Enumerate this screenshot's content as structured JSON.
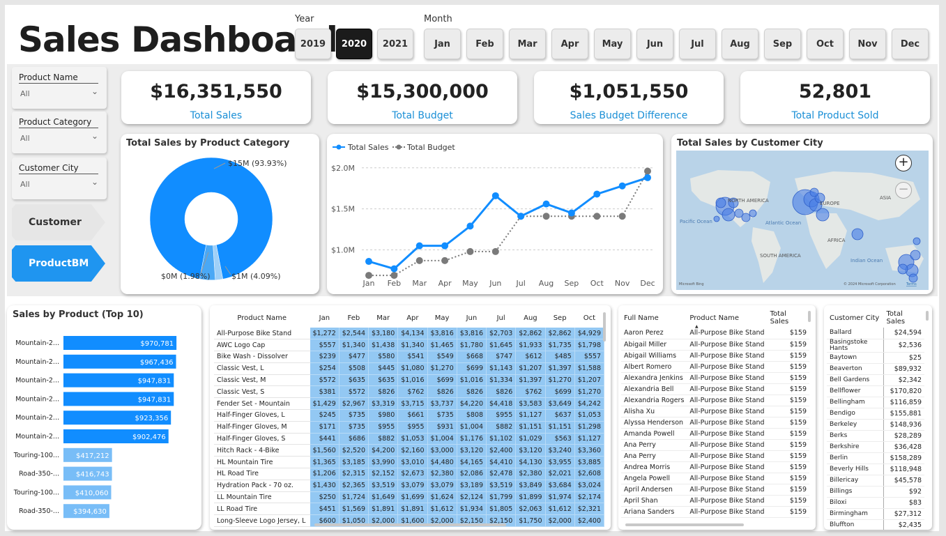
{
  "header": {
    "title": "Sales Dashboard"
  },
  "year_slicer": {
    "label": "Year",
    "options": [
      "2019",
      "2020",
      "2021"
    ],
    "selected": "2020"
  },
  "month_slicer": {
    "label": "Month",
    "options": [
      "Jan",
      "Feb",
      "Mar",
      "Apr",
      "May",
      "Jun",
      "Jul",
      "Aug",
      "Sep",
      "Oct",
      "Nov",
      "Dec"
    ]
  },
  "filters": [
    {
      "label": "Product Name",
      "value": "All"
    },
    {
      "label": "Product Category",
      "value": "All"
    },
    {
      "label": "Customer City",
      "value": "All"
    }
  ],
  "nav": {
    "customer": "Customer",
    "productbm": "ProductBM"
  },
  "kpis": [
    {
      "value": "$16,351,550",
      "label": "Total Sales"
    },
    {
      "value": "$15,300,000",
      "label": "Total Budget"
    },
    {
      "value": "$1,051,550",
      "label": "Sales Budget Difference"
    },
    {
      "value": "52,801",
      "label": "Total Product Sold"
    }
  ],
  "donut": {
    "title": "Total Sales by Product Category",
    "labels": [
      "$15M (93.93%)",
      "$0M (1.98%)",
      "$1M (4.09%)"
    ],
    "colors": [
      "#118dff",
      "#9fd0f8",
      "#4aa8f5"
    ]
  },
  "map": {
    "title": "Total Sales by Customer City",
    "labels": [
      "NORTH AMERICA",
      "EUROPE",
      "ASIA",
      "AFRICA",
      "SOUTH AMERICA",
      "Pacific Ocean",
      "Atlantic Ocean",
      "Indian Ocean"
    ],
    "attribution": "© 2024 Microsoft Corporation",
    "terms": "Terms",
    "logo": "Microsoft Bing"
  },
  "bar_table_title": "Sales by Product (Top 10)",
  "chart_data": [
    {
      "type": "pie",
      "title": "Total Sales by Product Category",
      "slices": [
        {
          "label": "$15M (93.93%)",
          "value": 93.93
        },
        {
          "label": "$0M (1.98%)",
          "value": 1.98
        },
        {
          "label": "$1M (4.09%)",
          "value": 4.09
        }
      ]
    },
    {
      "type": "line",
      "categories": [
        "Jan",
        "Feb",
        "Mar",
        "Apr",
        "May",
        "Jun",
        "Jul",
        "Aug",
        "Sep",
        "Oct",
        "Nov",
        "Dec"
      ],
      "yticks": [
        "$1.0M",
        "$1.5M",
        "$2.0M"
      ],
      "ylim": [
        0.75,
        2.1
      ],
      "series": [
        {
          "name": "Total Sales",
          "color": "#118dff",
          "values": [
            0.86,
            0.77,
            1.05,
            1.05,
            1.29,
            1.66,
            1.41,
            1.56,
            1.45,
            1.68,
            1.78,
            1.88
          ]
        },
        {
          "name": "Total Budget",
          "color": "#7a7a7a",
          "values": [
            0.69,
            0.69,
            0.87,
            0.87,
            0.98,
            0.98,
            1.41,
            1.41,
            1.41,
            1.41,
            1.41,
            1.96
          ]
        }
      ]
    },
    {
      "type": "bar",
      "title": "Sales by Product (Top 10)",
      "categories": [
        "Mountain-2...",
        "Mountain-2...",
        "Mountain-2...",
        "Mountain-2...",
        "Mountain-2...",
        "Mountain-2...",
        "Touring-100...",
        "Road-350-...",
        "Touring-100...",
        "Road-350-..."
      ],
      "values": [
        970781,
        967436,
        947831,
        947831,
        923356,
        902476,
        417212,
        416743,
        410060,
        394630
      ],
      "labels": [
        "$970,781",
        "$967,436",
        "$947,831",
        "$947,831",
        "$923,356",
        "$902,476",
        "$417,212",
        "$416,743",
        "$410,060",
        "$394,630"
      ],
      "xlim": [
        0,
        1000000
      ]
    }
  ],
  "matrix": {
    "headers": [
      "Product Name",
      "Jan",
      "Feb",
      "Mar",
      "Apr",
      "May",
      "Jun",
      "Jul",
      "Aug",
      "Sep",
      "Oct"
    ],
    "rows": [
      [
        "All-Purpose Bike Stand",
        "$1,272",
        "$2,544",
        "$3,180",
        "$4,134",
        "$3,816",
        "$3,816",
        "$2,703",
        "$2,862",
        "$2,862",
        "$4,929"
      ],
      [
        "AWC Logo Cap",
        "$557",
        "$1,340",
        "$1,438",
        "$1,340",
        "$1,465",
        "$1,780",
        "$1,645",
        "$1,933",
        "$1,735",
        "$1,798"
      ],
      [
        "Bike Wash - Dissolver",
        "$239",
        "$477",
        "$580",
        "$541",
        "$549",
        "$668",
        "$747",
        "$612",
        "$485",
        "$557"
      ],
      [
        "Classic Vest, L",
        "$254",
        "$508",
        "$445",
        "$1,080",
        "$1,270",
        "$699",
        "$1,143",
        "$1,207",
        "$1,397",
        "$1,588"
      ],
      [
        "Classic Vest, M",
        "$572",
        "$635",
        "$635",
        "$1,016",
        "$699",
        "$1,016",
        "$1,334",
        "$1,397",
        "$1,270",
        "$1,207"
      ],
      [
        "Classic Vest, S",
        "$381",
        "$572",
        "$826",
        "$762",
        "$826",
        "$826",
        "$826",
        "$762",
        "$699",
        "$1,270"
      ],
      [
        "Fender Set - Mountain",
        "$1,429",
        "$2,967",
        "$3,319",
        "$3,715",
        "$3,737",
        "$4,220",
        "$4,418",
        "$3,583",
        "$3,649",
        "$4,242"
      ],
      [
        "Half-Finger Gloves, L",
        "$245",
        "$735",
        "$980",
        "$661",
        "$735",
        "$808",
        "$955",
        "$1,127",
        "$637",
        "$1,053"
      ],
      [
        "Half-Finger Gloves, M",
        "$171",
        "$735",
        "$955",
        "$955",
        "$931",
        "$1,004",
        "$882",
        "$1,151",
        "$1,151",
        "$1,298"
      ],
      [
        "Half-Finger Gloves, S",
        "$441",
        "$686",
        "$882",
        "$1,053",
        "$1,004",
        "$1,176",
        "$1,102",
        "$1,029",
        "$563",
        "$1,127"
      ],
      [
        "Hitch Rack - 4-Bike",
        "$1,560",
        "$2,520",
        "$4,200",
        "$2,160",
        "$3,000",
        "$3,120",
        "$2,400",
        "$3,120",
        "$3,240",
        "$3,360"
      ],
      [
        "HL Mountain Tire",
        "$1,365",
        "$3,185",
        "$3,990",
        "$3,010",
        "$4,480",
        "$4,165",
        "$4,410",
        "$4,130",
        "$3,955",
        "$3,885"
      ],
      [
        "HL Road Tire",
        "$1,206",
        "$2,315",
        "$2,152",
        "$2,673",
        "$2,380",
        "$2,086",
        "$2,478",
        "$2,380",
        "$2,021",
        "$2,608"
      ],
      [
        "Hydration Pack - 70 oz.",
        "$1,430",
        "$2,365",
        "$3,519",
        "$3,079",
        "$3,079",
        "$3,189",
        "$3,519",
        "$3,849",
        "$3,684",
        "$3,024"
      ],
      [
        "LL Mountain Tire",
        "$250",
        "$1,724",
        "$1,649",
        "$1,699",
        "$1,624",
        "$2,124",
        "$1,799",
        "$1,899",
        "$1,974",
        "$2,174"
      ],
      [
        "LL Road Tire",
        "$451",
        "$1,569",
        "$1,891",
        "$1,891",
        "$1,612",
        "$1,934",
        "$1,805",
        "$2,063",
        "$1,612",
        "$2,321"
      ],
      [
        "Long-Sleeve Logo Jersey, L",
        "$600",
        "$1,050",
        "$2,000",
        "$1,600",
        "$2,000",
        "$2,150",
        "$2,150",
        "$1,750",
        "$2,000",
        "$2,400"
      ]
    ]
  },
  "customers": {
    "headers": [
      "Full Name",
      "Product Name",
      "Total Sales"
    ],
    "rows": [
      [
        "Aaron Perez",
        "All-Purpose Bike Stand",
        "$159"
      ],
      [
        "Abigail Miller",
        "All-Purpose Bike Stand",
        "$159"
      ],
      [
        "Abigail Williams",
        "All-Purpose Bike Stand",
        "$159"
      ],
      [
        "Albert Romero",
        "All-Purpose Bike Stand",
        "$159"
      ],
      [
        "Alexandra Jenkins",
        "All-Purpose Bike Stand",
        "$159"
      ],
      [
        "Alexandria Bell",
        "All-Purpose Bike Stand",
        "$159"
      ],
      [
        "Alexandria Rogers",
        "All-Purpose Bike Stand",
        "$159"
      ],
      [
        "Alisha Xu",
        "All-Purpose Bike Stand",
        "$159"
      ],
      [
        "Alyssa Henderson",
        "All-Purpose Bike Stand",
        "$159"
      ],
      [
        "Amanda Powell",
        "All-Purpose Bike Stand",
        "$159"
      ],
      [
        "Ana Perry",
        "All-Purpose Bike Stand",
        "$159"
      ],
      [
        "Ana Perry",
        "All-Purpose Bike Stand",
        "$159"
      ],
      [
        "Andrea Morris",
        "All-Purpose Bike Stand",
        "$159"
      ],
      [
        "Angela Powell",
        "All-Purpose Bike Stand",
        "$159"
      ],
      [
        "April Andersen",
        "All-Purpose Bike Stand",
        "$159"
      ],
      [
        "April Shan",
        "All-Purpose Bike Stand",
        "$159"
      ],
      [
        "Ariana Sanders",
        "All-Purpose Bike Stand",
        "$159"
      ]
    ]
  },
  "cities": {
    "headers": [
      "Customer City",
      "Total Sales"
    ],
    "rows": [
      [
        "Ballard",
        "$24,594"
      ],
      [
        "Basingstoke Hants",
        "$2,536"
      ],
      [
        "Baytown",
        "$25"
      ],
      [
        "Beaverton",
        "$89,932"
      ],
      [
        "Bell Gardens",
        "$2,342"
      ],
      [
        "Bellflower",
        "$170,820"
      ],
      [
        "Bellingham",
        "$116,859"
      ],
      [
        "Bendigo",
        "$155,881"
      ],
      [
        "Berkeley",
        "$148,936"
      ],
      [
        "Berks",
        "$28,289"
      ],
      [
        "Berkshire",
        "$36,428"
      ],
      [
        "Berlin",
        "$158,289"
      ],
      [
        "Beverly Hills",
        "$118,948"
      ],
      [
        "Billericay",
        "$45,578"
      ],
      [
        "Billings",
        "$92"
      ],
      [
        "Biloxi",
        "$83"
      ],
      [
        "Birmingham",
        "$27,312"
      ],
      [
        "Bluffton",
        "$2,435"
      ]
    ]
  }
}
